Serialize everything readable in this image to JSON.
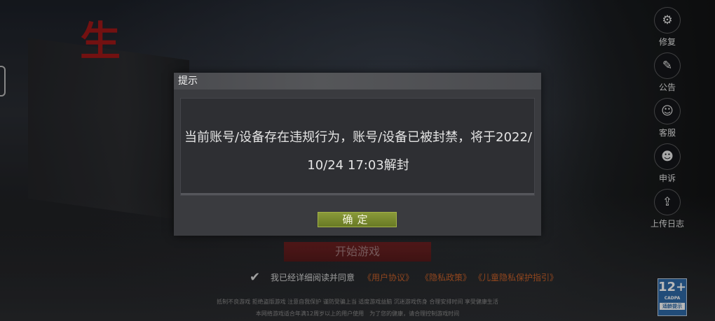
{
  "logo": {
    "glyph": "生"
  },
  "side_menu": [
    {
      "icon": "gear-repair-icon",
      "glyph": "⚙",
      "label": "修复"
    },
    {
      "icon": "notice-icon",
      "glyph": "✎",
      "label": "公告"
    },
    {
      "icon": "customer-service-icon",
      "glyph": "☺",
      "label": "客服"
    },
    {
      "icon": "appeal-icon",
      "glyph": "☻",
      "label": "申诉"
    },
    {
      "icon": "upload-icon",
      "glyph": "⇪",
      "label": "上传日志"
    }
  ],
  "start_button": "开始游戏",
  "agreement": {
    "text": "我已经详细阅读并同意",
    "links": [
      "《用户协议》",
      "《隐私政策》",
      "《儿童隐私保护指引》"
    ]
  },
  "health_notice": [
    "抵制不良游戏 拒绝盗版游戏 注意自我保护 谨防受骗上当 适度游戏益脑 沉迷游戏伤身 合理安排时间 享受健康生活",
    "本网络游戏适合年满12周岁以上的用户使用　为了您的健康，请合理控制游戏时间"
  ],
  "age_rating": {
    "number": "12+",
    "org": "CADPA",
    "footer": "适龄提示"
  },
  "dialog": {
    "title": "提示",
    "message": "当前账号/设备存在违规行为，账号/设备已被封禁，将于2022/10/24 17:03解封",
    "ok_label": "确定"
  }
}
